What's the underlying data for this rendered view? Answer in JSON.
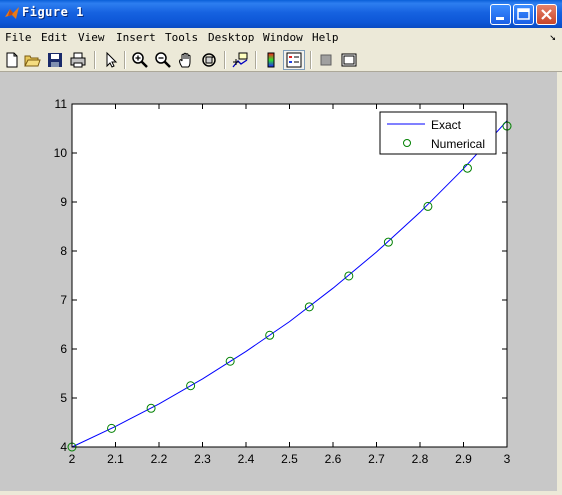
{
  "window": {
    "title": "Figure 1",
    "controls": [
      "minimize",
      "maximize",
      "close"
    ]
  },
  "menu": {
    "items": [
      "File",
      "Edit",
      "View",
      "Insert",
      "Tools",
      "Desktop",
      "Window",
      "Help"
    ],
    "overflow_glyph": "↘"
  },
  "toolbar": {
    "buttons": [
      "new-figure",
      "open-file",
      "save",
      "print",
      "edit-plot",
      "zoom-in",
      "zoom-out",
      "pan",
      "rotate-3d",
      "data-cursor",
      "insert-colorbar",
      "insert-legend",
      "hide-plot-tools",
      "show-plot-tools"
    ]
  },
  "colors": {
    "exact_line": "#0000ff",
    "numerical_marker": "#008000",
    "figure_bg": "#c8c8c8",
    "axes_bg": "#ffffff"
  },
  "chart_data": {
    "type": "line",
    "xlim": [
      2,
      3
    ],
    "ylim": [
      4,
      11
    ],
    "xticks": [
      "2",
      "2.1",
      "2.2",
      "2.3",
      "2.4",
      "2.5",
      "2.6",
      "2.7",
      "2.8",
      "2.9",
      "3"
    ],
    "yticks": [
      "4",
      "5",
      "6",
      "7",
      "8",
      "9",
      "10",
      "11"
    ],
    "grid": false,
    "legend_position": "top-right",
    "series": [
      {
        "name": "Exact",
        "style": "solid line",
        "x": [
          2.0,
          2.1,
          2.2,
          2.3,
          2.4,
          2.5,
          2.6,
          2.7,
          2.8,
          2.9,
          3.0
        ],
        "y": [
          4.0,
          4.42,
          4.88,
          5.39,
          5.95,
          6.56,
          7.24,
          7.98,
          8.79,
          9.68,
          10.66
        ]
      },
      {
        "name": "Numerical",
        "style": "circle markers",
        "x": [
          2.0,
          2.0909,
          2.1818,
          2.2727,
          2.3636,
          2.4545,
          2.5455,
          2.6364,
          2.7273,
          2.8182,
          2.9091,
          3.0
        ],
        "y": [
          4.0,
          4.38,
          4.79,
          5.25,
          5.75,
          6.28,
          6.86,
          7.49,
          8.18,
          8.91,
          9.69,
          10.55
        ]
      }
    ]
  }
}
